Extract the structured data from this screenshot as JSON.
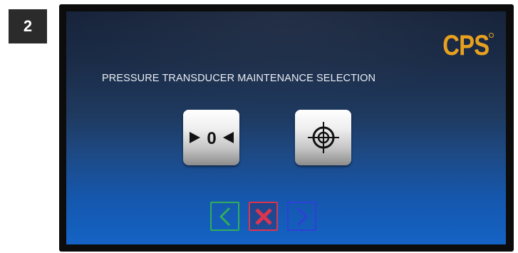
{
  "step": {
    "number": "2"
  },
  "screen": {
    "logo_text": "CPS",
    "title": "PRESSURE TRANSDUCER MAINTENANCE SELECTION",
    "options": [
      {
        "icon": "zero-adjust-icon"
      },
      {
        "icon": "crosshair-target-icon"
      }
    ],
    "nav": {
      "back": {
        "icon": "chevron-left-icon",
        "color": "#2fae5a"
      },
      "cancel": {
        "icon": "close-x-icon",
        "color": "#e0334d"
      },
      "next": {
        "icon": "chevron-right-icon",
        "color": "#2f3fd6"
      }
    }
  },
  "colors": {
    "logo": "#e8a11f",
    "screen_top": "#17233a",
    "screen_bottom": "#1463c4",
    "badge": "#2b2b2b"
  }
}
